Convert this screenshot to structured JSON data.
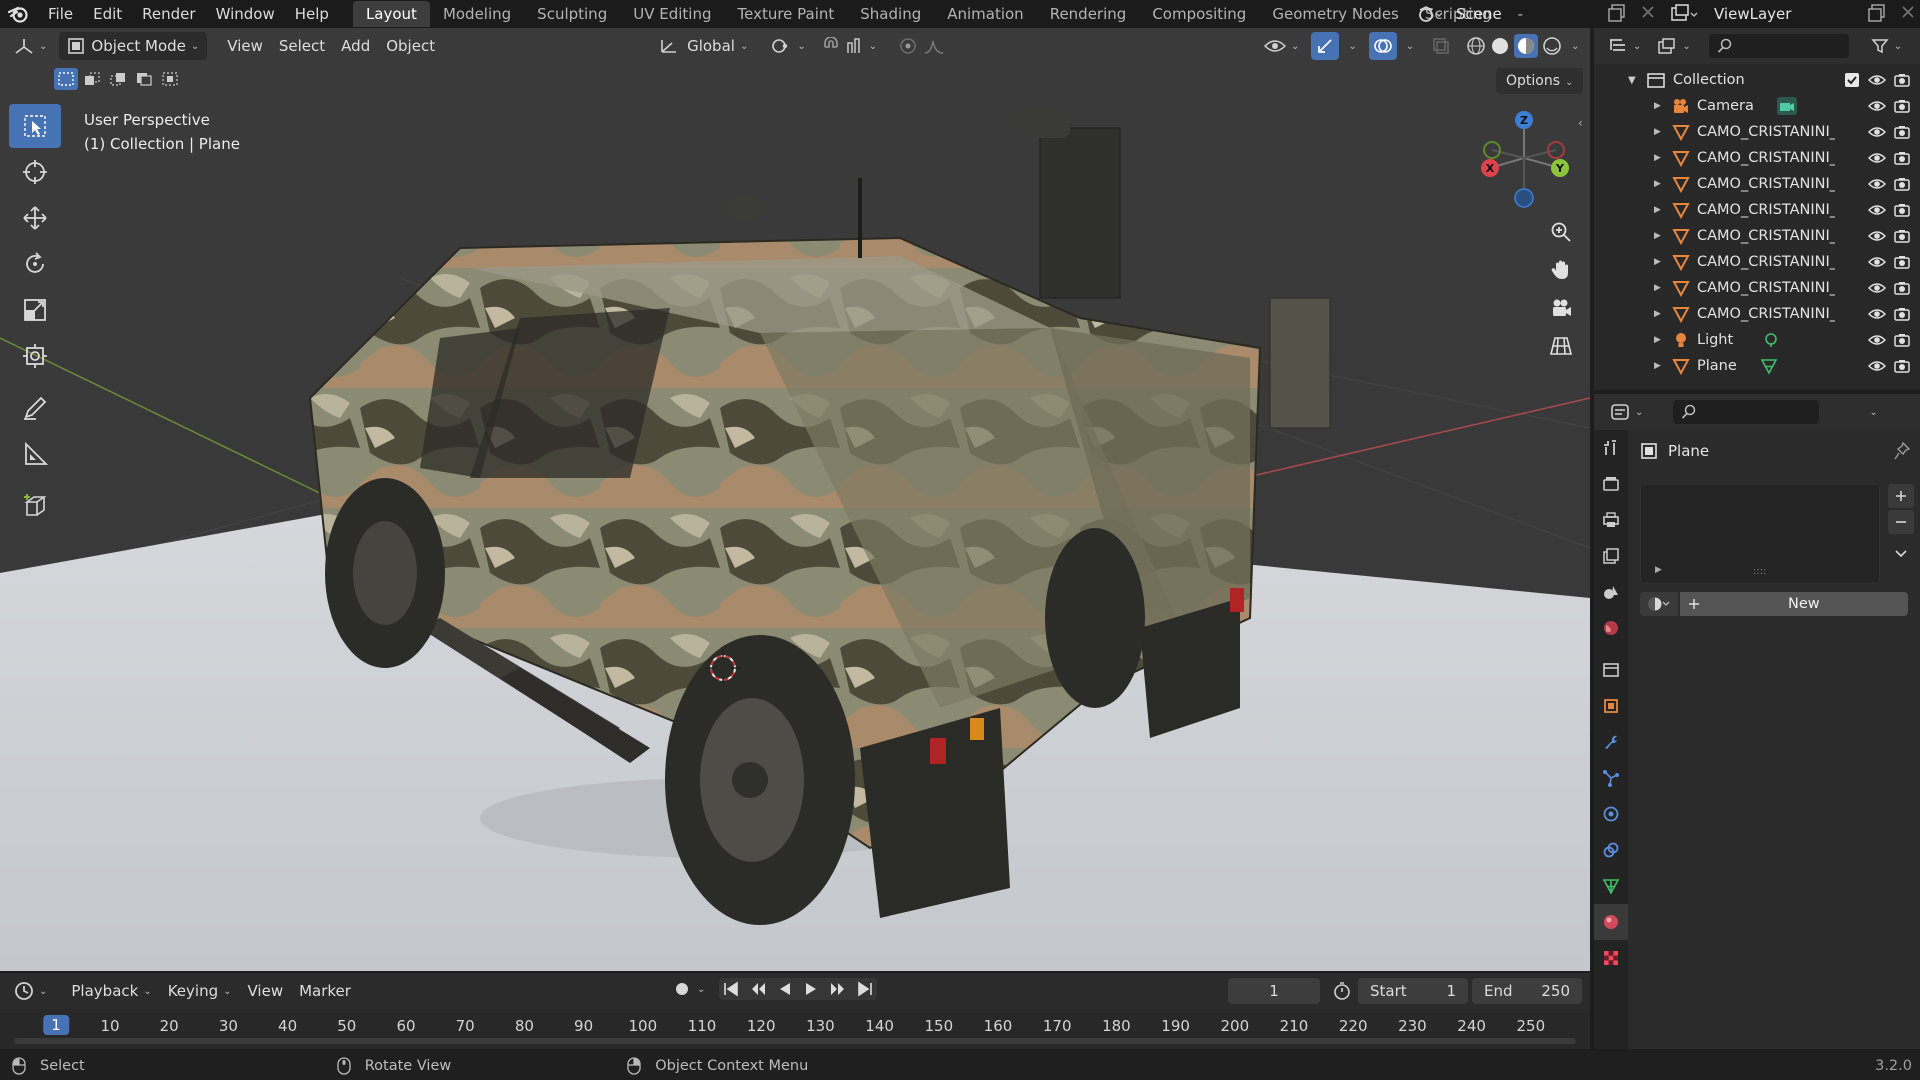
{
  "menu": [
    "File",
    "Edit",
    "Render",
    "Window",
    "Help"
  ],
  "workspaces": [
    "Layout",
    "Modeling",
    "Sculpting",
    "UV Editing",
    "Texture Paint",
    "Shading",
    "Animation",
    "Rendering",
    "Compositing",
    "Geometry Nodes",
    "Scripting"
  ],
  "workspace_more": "-",
  "scene": "Scene",
  "view_layer": "ViewLayer",
  "viewport": {
    "mode": "Object Mode",
    "menus": [
      "View",
      "Select",
      "Add",
      "Object"
    ],
    "orientation": "Global",
    "options": "Options",
    "info_line1": "User Perspective",
    "info_line2": "(1) Collection | Plane",
    "gizmo": {
      "z": "Z",
      "y": "Y",
      "x": "X"
    }
  },
  "outliner": {
    "collection": "Collection",
    "items": [
      {
        "name": "Camera",
        "icon": "camera"
      },
      {
        "name": "CAMO_CRISTANINI_E",
        "icon": "mesh"
      },
      {
        "name": "CAMO_CRISTANINI_C",
        "icon": "mesh"
      },
      {
        "name": "CAMO_CRISTANINI_F",
        "icon": "mesh"
      },
      {
        "name": "CAMO_CRISTANINI_F",
        "icon": "mesh"
      },
      {
        "name": "CAMO_CRISTANINI_F",
        "icon": "mesh"
      },
      {
        "name": "CAMO_CRISTANINI_F",
        "icon": "mesh"
      },
      {
        "name": "CAMO_CRISTANINI_F",
        "icon": "mesh"
      },
      {
        "name": "CAMO_CRISTANINI_F",
        "icon": "mesh"
      },
      {
        "name": "Light",
        "icon": "light"
      },
      {
        "name": "Plane",
        "icon": "mesh"
      }
    ]
  },
  "properties": {
    "object_name": "Plane",
    "new_button": "New",
    "handle": "::::"
  },
  "timeline": {
    "menus": [
      "Playback",
      "Keying",
      "View",
      "Marker"
    ],
    "current_frame": "1",
    "start_label": "Start",
    "start_value": "1",
    "end_label": "End",
    "end_value": "250",
    "ticks": [
      "1",
      "10",
      "20",
      "30",
      "40",
      "50",
      "60",
      "70",
      "80",
      "90",
      "100",
      "110",
      "120",
      "130",
      "140",
      "150",
      "160",
      "170",
      "180",
      "190",
      "200",
      "210",
      "220",
      "230",
      "240",
      "250"
    ]
  },
  "status": {
    "select": "Select",
    "rotate": "Rotate View",
    "context": "Object Context Menu",
    "version": "3.2.0"
  },
  "colors": {
    "accent": "#4772b3",
    "x_axis": "#e0424d",
    "y_axis": "#8cc43c",
    "z_axis": "#3b7fd6",
    "mesh_icon": "#e8853d"
  }
}
